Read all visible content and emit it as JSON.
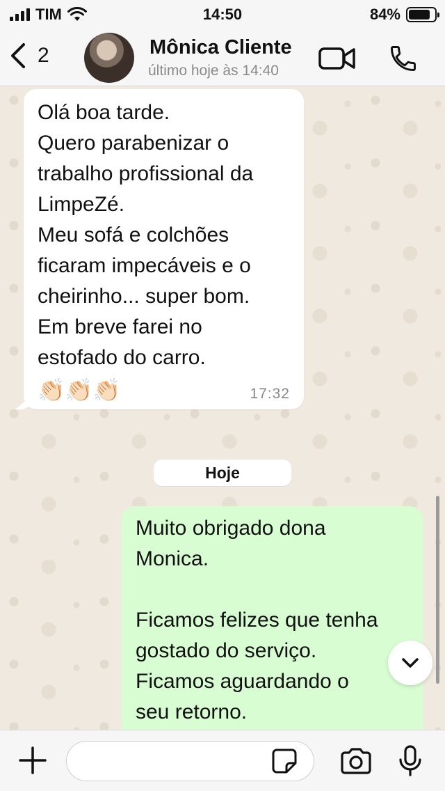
{
  "status_bar": {
    "carrier": "TIM",
    "time": "14:50",
    "battery_percent": "84%",
    "battery_level": 0.84,
    "signal_bars": 4
  },
  "header": {
    "back_count": "2",
    "contact_name": "Mônica Cliente",
    "contact_status": "último hoje às 14:40"
  },
  "messages": [
    {
      "direction": "incoming",
      "text": "Olá boa tarde.\nQuero parabenizar o\ntrabalho profissional da\nLimpeZé.\nMeu sofá e colchões\nficaram impecáveis e o\ncheirinho... super bom.\nEm breve farei no\nestofado do carro.",
      "emoji": "👏🏻👏🏻👏🏻",
      "time": "17:32"
    },
    {
      "direction": "outgoing",
      "text": "Muito obrigado dona\nMonica.\n\nFicamos felizes que tenha\ngostado do serviço.\nFicamos aguardando o\nseu retorno."
    }
  ],
  "date_separator": "Hoje",
  "input": {
    "value": "",
    "placeholder": ""
  },
  "colors": {
    "incoming_bubble": "#ffffff",
    "outgoing_bubble": "#d9fdd3",
    "chat_background": "#efe9df",
    "bar_background": "#f6f6f6"
  },
  "icons": {
    "back": "chevron-left-icon",
    "video": "video-call-icon",
    "call": "phone-icon",
    "scroll_down": "chevron-down-icon",
    "plus": "plus-icon",
    "sticker": "sticker-icon",
    "camera": "camera-icon",
    "mic": "microphone-icon"
  }
}
